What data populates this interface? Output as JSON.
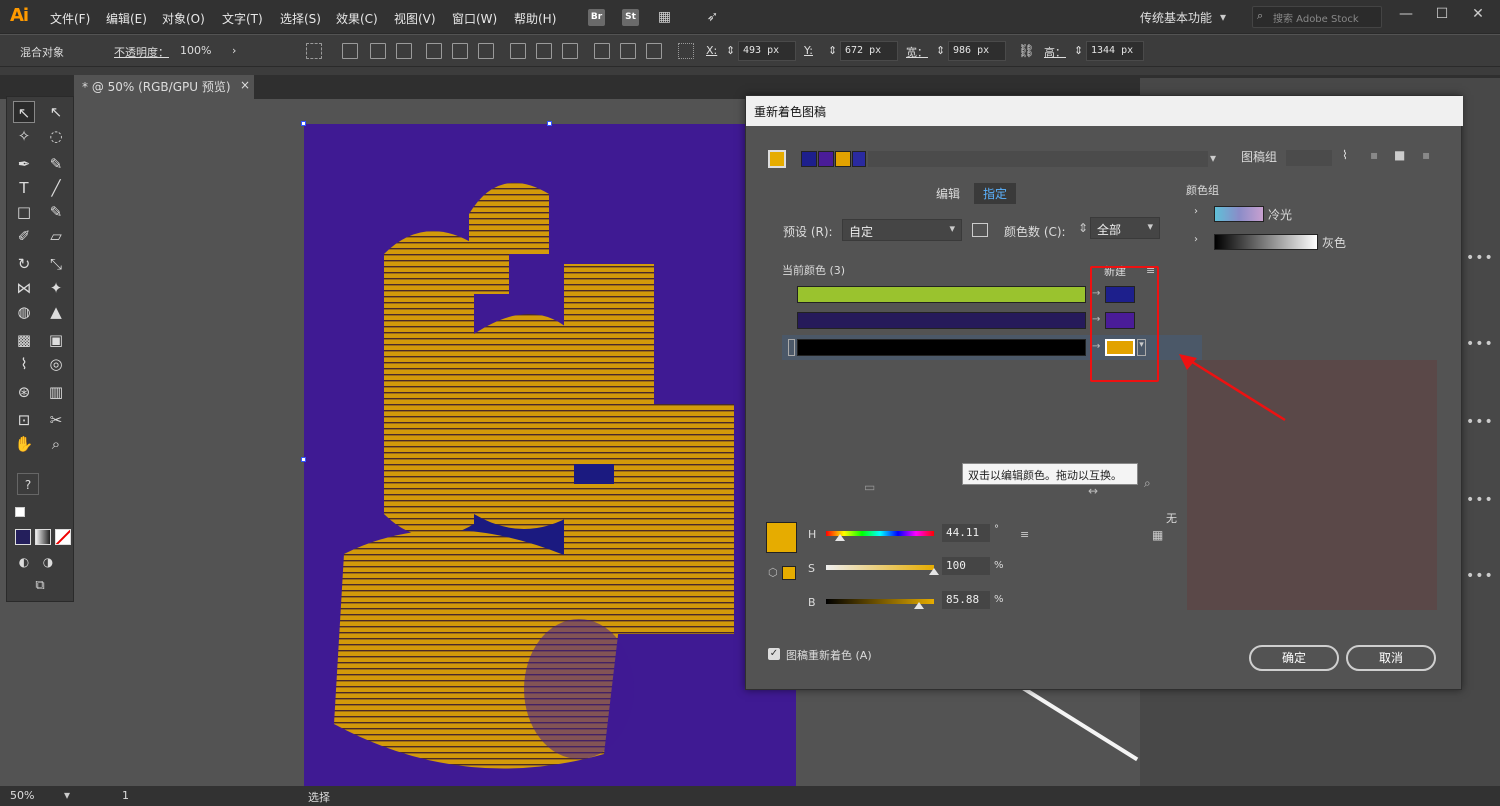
{
  "menubar": {
    "logo": "Ai",
    "items": [
      "文件(F)",
      "编辑(E)",
      "对象(O)",
      "文字(T)",
      "选择(S)",
      "效果(C)",
      "视图(V)",
      "窗口(W)",
      "帮助(H)"
    ],
    "bridge_label": "Br",
    "stock_label": "St",
    "workspace": "传统基本功能",
    "search_placeholder": "搜索 Adobe Stock"
  },
  "controlbar": {
    "selection_label": "混合对象",
    "opacity_label": "不透明度：",
    "opacity_value": "100%",
    "x_label": "X:",
    "x_value": "493 px",
    "y_label": "Y:",
    "y_value": "672 px",
    "w_label": "宽：",
    "w_value": "986 px",
    "h_label": "高：",
    "h_value": "1344 px"
  },
  "doc_tab": {
    "label": "* @ 50% (RGB/GPU 预览)",
    "close": "×"
  },
  "toolbar": {
    "question": "?"
  },
  "dialog": {
    "title": "重新着色图稿",
    "artwork_group_label": "图稿组",
    "tabs": [
      "编辑",
      "指定"
    ],
    "preset_label": "预设 (R):",
    "preset_value": "自定",
    "colors_label": "颜色数 (C):",
    "colors_value": "全部",
    "current_colors_label": "当前颜色 (3)",
    "new_label": "新建",
    "tooltip": "双击以编辑颜色。拖动以互换。",
    "h_label": "H",
    "h_value": "44.11",
    "h_unit": "°",
    "s_label": "S",
    "s_value": "100",
    "s_unit": "%",
    "b_label": "B",
    "b_value": "85.88",
    "b_unit": "%",
    "none_label": "无",
    "recolor_checkbox_label": "图稿重新着色 (A)",
    "ok_label": "确定",
    "cancel_label": "取消",
    "color_groups_label": "颜色组",
    "color_groups": [
      {
        "name": "冷光"
      },
      {
        "name": "灰色"
      }
    ],
    "current_colors": [
      {
        "current": "#9ac32e",
        "new": "#1d1f8c"
      },
      {
        "current": "#261a5a",
        "new": "#4a1c98"
      },
      {
        "current": "#000000",
        "new": "#e2a200"
      }
    ],
    "selected_color": "#e6ac00"
  },
  "bottombar": {
    "zoom": "50%",
    "page": "1",
    "status": "选择"
  },
  "colors": {
    "artboard_bg": "#3f1a93",
    "letter_fill": "#d39a0a",
    "highlight": "#e11111"
  }
}
